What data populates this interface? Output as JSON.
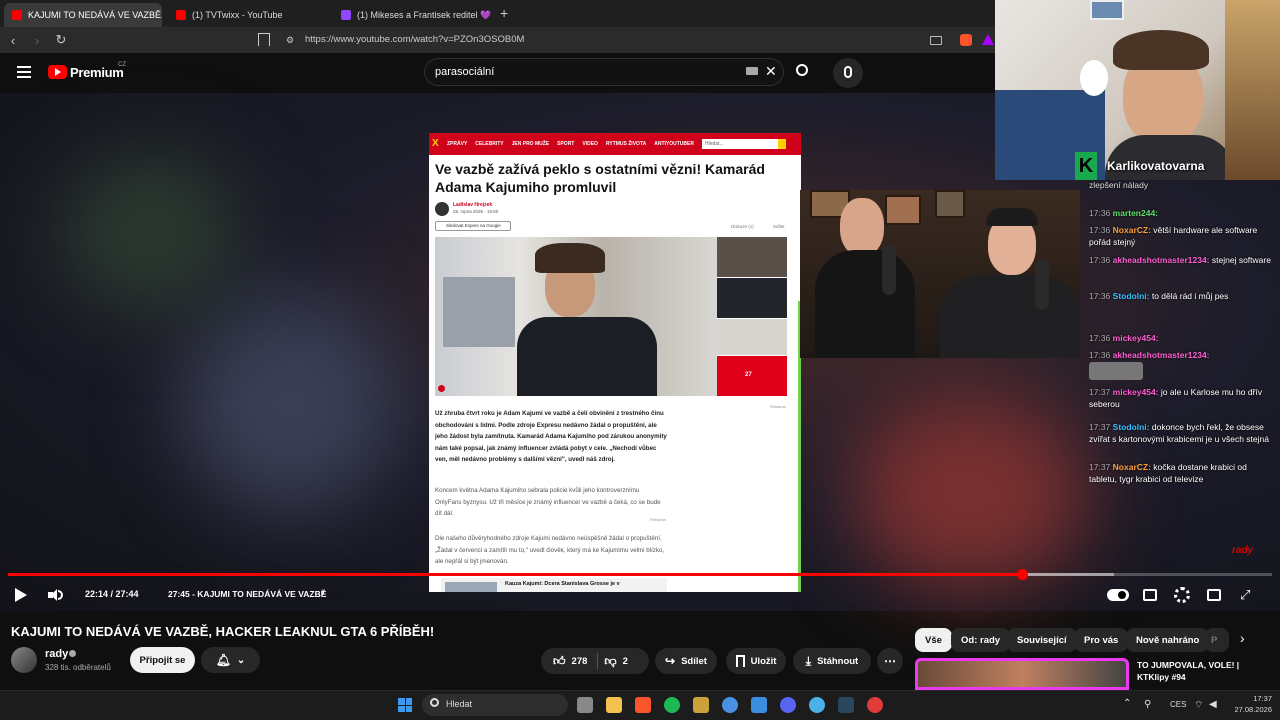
{
  "browser": {
    "tabs": [
      {
        "label": "KAJUMI TO NEDÁVÁ VE VAZBĚ, H",
        "color": "#ff0000"
      },
      {
        "label": "(1) TVTwixx - YouTube",
        "color": "#ff0000"
      },
      {
        "label": "(1) Mikeses a Frantisek reditel 💜 - T",
        "color": "#9146ff"
      }
    ],
    "url": "https://www.youtube.com/watch?v=PZOn3OSOB0M"
  },
  "youtube": {
    "logo": "Premium",
    "region": "CZ",
    "search_query": "parasociální"
  },
  "article": {
    "nav": [
      "ZPRÁVY",
      "CELEBRITY",
      "JEN PRO MUŽE",
      "SPORT",
      "VIDEO",
      "RYTMUS ŽIVOTA",
      "ANTIYOUTUBER"
    ],
    "search_placeholder": "Hledat...",
    "title": "Ve vazbě zažívá peklo s ostatními vězni! Kamarád Adama Kajumiho promluvil",
    "author": "Ladislav Hrejzek",
    "date": "25. srpna 2026 · 19:50",
    "follow": "Sledovat Expres na Google",
    "discussion": "Diskuze (1)",
    "share": "Sdílet",
    "gallery_count": "27",
    "ad_label": "Reklama",
    "lead": "Už zhruba čtvrt roku je Adam Kajumi ve vazbě a čelí obvinění z trestného činu obchodování s lidmi. Podle zdroje Expresu nedávno žádal o propuštění, ale jeho žádost byla zamítnuta. Kamarád Adama Kajumiho pod zárukou anonymity nám také popsal, jak známý influencer zvládá pobyt v cele. „Nechodí vůbec ven, měl nedávno problémy s dalšími vězni\", uvedl náš zdroj.",
    "para2": "Koncem května Adama Kajumiho sebrala policie kvůli jeho kontroverznímu OnlyFans byznysu. Už tři měsíce je známý influencer ve vazbě a čeká, co se bude dít dál.",
    "para3": "Dle našeho důvěryhodného zdroje Kajumi nedávno neúspěšně žádal o propuštění. „Žádal v červenci a zamítli mu to,\" uvedl člověk, který má ke Kajumimu velmi blízko, ale nepřál si být jmenován.",
    "related": "Kauza Kajumi: Dcera Stanislava Grosse je v"
  },
  "stream": {
    "channel": "Karlikovatovarna",
    "chat_top": "zlepšení nálady",
    "chat": [
      {
        "time": "17:36",
        "user": "marten244:",
        "color": "#5ee06a",
        "text": ""
      },
      {
        "time": "17:36",
        "user": "NoxarCZ:",
        "color": "#ff9e3d",
        "text": "větší hardware ale software pořád stejný"
      },
      {
        "time": "17:36",
        "user": "akheadshotmaster1234:",
        "color": "#ff5fd2",
        "text": "stejnej software"
      },
      {
        "time": "17:36",
        "user": "Stodolni:",
        "color": "#3cc0ff",
        "text": "to dělá rád i můj pes"
      },
      {
        "time": "17:36",
        "user": "mickey454:",
        "color": "#ff5fd2",
        "text": ""
      },
      {
        "time": "17:36",
        "user": "akheadshotmaster1234:",
        "color": "#ff5fd2",
        "text": ""
      },
      {
        "time": "17:37",
        "user": "mickey454:",
        "color": "#ff5fd2",
        "text": "jo ale u Karlose mu ho dřív seberou"
      },
      {
        "time": "17:37",
        "user": "Stodolni:",
        "color": "#3cc0ff",
        "text": "dokonce bych řekl, že obsese zvířat s kartonovými krabicemi je u všech stejná"
      },
      {
        "time": "17:37",
        "user": "NoxarCZ:",
        "color": "#ff9e3d",
        "text": "kočka dostane krabici od tabletu, tygr krabici od televize"
      }
    ],
    "corner_tag": "rady"
  },
  "player": {
    "time": "22:14 / 27:44",
    "chapter": "27:45 - KAJUMI TO NEDÁVÁ VE VAZBĚ",
    "progress": 0.802,
    "buffered": 0.875
  },
  "video": {
    "title": "KAJUMI TO NEDÁVÁ VE VAZBĚ, HACKER LEAKNUL GTA 6 PŘÍBĚH!",
    "channel": "rady",
    "subscribers": "328 tis. odběratelů",
    "join": "Připojit se",
    "likes": "278",
    "dislikes": "2",
    "share": "Sdílet",
    "save": "Uložit",
    "download": "Stáhnout"
  },
  "chips": [
    "Vše",
    "Od: rady",
    "Související",
    "Pro vás",
    "Nově nahráno",
    "P"
  ],
  "recommended": {
    "title": "TO JUMPOVALA, VOLE! | KTKlipy #94"
  },
  "taskbar": {
    "search": "Hledat",
    "lang": "CES",
    "time": "17:37",
    "date": "27.08.2026"
  }
}
